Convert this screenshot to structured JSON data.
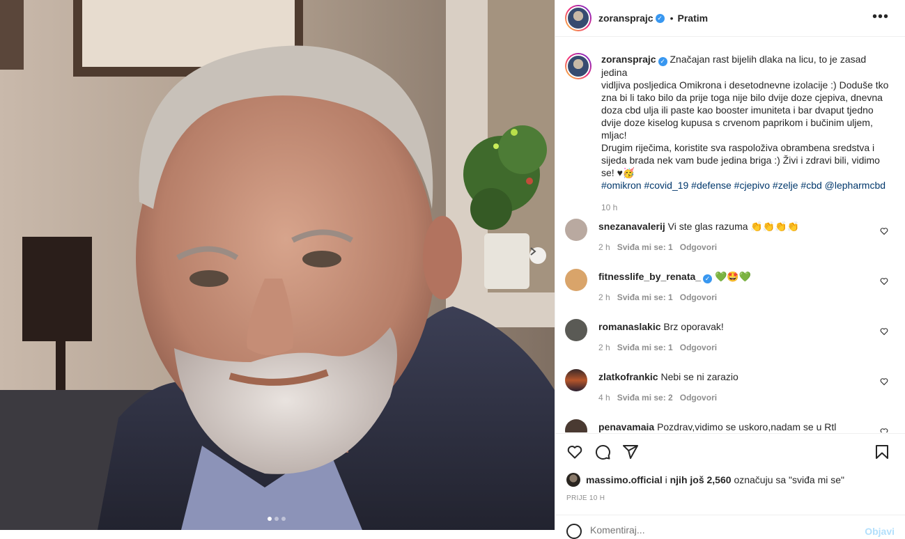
{
  "header": {
    "username": "zoransprajc",
    "separator": "•",
    "follow_label": "Pratim",
    "more_label": "•••"
  },
  "caption": {
    "username": "zoransprajc",
    "lines": [
      "Značajan rast bijelih dlaka na licu, to je zasad jedina",
      "vidljiva posljedica Omikrona i desetodnevne izolacije :) Doduše tko",
      "zna bi li tako bilo da prije toga nije bilo dvije doze cjepiva, dnevna",
      "doza cbd ulja ili paste kao booster imuniteta i bar dvaput tjedno",
      "dvije doze kiselog kupusa s crvenom paprikom i bučinim uljem,",
      "mljac!",
      "Drugim riječima, koristite sva raspoloživa obrambena sredstva i",
      "sijeda brada nek vam bude jedina briga :) Živi i zdravi bili, vidimo",
      "se! ♥🥳"
    ],
    "hashtags": "#omikron #covid_19 #defense #cjepivo #zelje #cbd @lepharmcbd",
    "time": "10 h"
  },
  "comments": [
    {
      "username": "snezanavalerij",
      "text": "Vi ste glas razuma 👏👏👏👏",
      "time": "2 h",
      "likes": "Sviđa mi se: 1",
      "reply": "Odgovori",
      "avatar_color": "#b9a9a0"
    },
    {
      "username": "fitnesslife_by_renata_",
      "verified": true,
      "text": "💚🤩💚",
      "time": "2 h",
      "likes": "Sviđa mi se: 1",
      "reply": "Odgovori",
      "avatar_color": "#d9a46a"
    },
    {
      "username": "romanaslakic",
      "text": "Brz oporavak!",
      "time": "2 h",
      "likes": "Sviđa mi se: 1",
      "reply": "Odgovori",
      "avatar_color": "#5a5a55"
    },
    {
      "username": "zlatkofrankic",
      "text": "Nebi se ni zarazio",
      "time": "4 h",
      "likes": "Sviđa mi se: 2",
      "reply": "Odgovori",
      "avatar_color": "#b5552b"
    },
    {
      "username": "penavamaia",
      "text": "Pozdrav,vidimo se uskoro,nadam se u Rtl",
      "time": "",
      "likes": "",
      "reply": "",
      "avatar_color": "#4a3a32"
    }
  ],
  "likes": {
    "user": "massimo.official",
    "connector": "i",
    "others": "njih još 2,560",
    "suffix": "označuju sa \"sviđa mi se\""
  },
  "posted_ago": "PRIJE 10 H",
  "add_comment": {
    "placeholder": "Komentiraj...",
    "post_label": "Objavi"
  },
  "colors": {
    "verified": "#3897f0",
    "link": "#00376b",
    "secondary_text": "#8e8e8e",
    "border": "#efefef"
  },
  "icons": [
    "chevron-right-icon",
    "more-icon",
    "heart-icon",
    "comment-icon",
    "share-icon",
    "bookmark-icon",
    "emoji-icon",
    "verified-icon"
  ]
}
